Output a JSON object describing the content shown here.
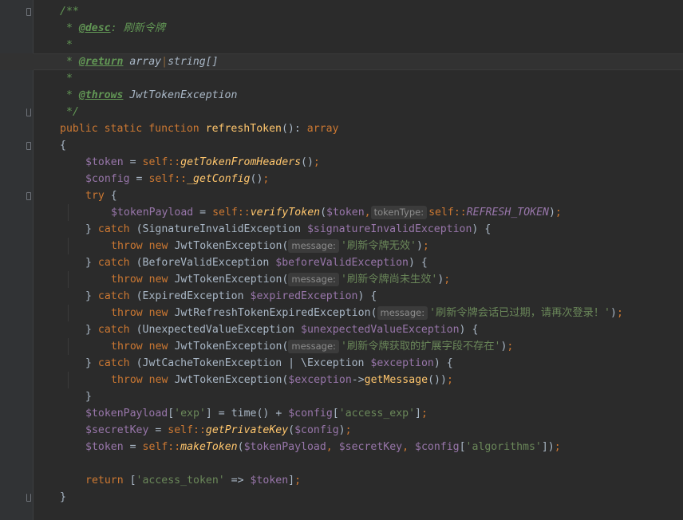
{
  "editor": {
    "lines": [
      "/**",
      " * @desc: 刷新令牌",
      " *",
      " * @return array|string[]",
      " *",
      " * @throws JwtTokenException",
      " */",
      "public static function refreshToken(): array",
      "{",
      "    $token = self::getTokenFromHeaders();",
      "    $config = self::_getConfig();",
      "    try {",
      "        $tokenPayload = self::verifyToken($token, tokenType: self::REFRESH_TOKEN);",
      "    } catch (SignatureInvalidException $signatureInvalidException) {",
      "        throw new JwtTokenException( message: '刷新令牌无效');",
      "    } catch (BeforeValidException $beforeValidException) {",
      "        throw new JwtTokenException( message: '刷新令牌尚未生效');",
      "    } catch (ExpiredException $expiredException) {",
      "        throw new JwtRefreshTokenExpiredException( message: '刷新令牌会话已过期，请再次登录！');",
      "    } catch (UnexpectedValueException $unexpectedValueException) {",
      "        throw new JwtTokenException( message: '刷新令牌获取的扩展字段不存在');",
      "    } catch (JwtCacheTokenException | \\Exception $exception) {",
      "        throw new JwtTokenException($exception->getMessage());",
      "    }",
      "    $tokenPayload['exp'] = time() + $config['access_exp'];",
      "    $secretKey = self::getPrivateKey($config);",
      "    $token = self::makeToken($tokenPayload, $secretKey, $config['algorithms']);",
      "",
      "    return ['access_token' => $token];",
      "}"
    ],
    "caret_line": 4,
    "colors": {
      "background": "#2b2b2b",
      "gutter": "#313335",
      "keyword": "#cc7832",
      "function": "#ffc66d",
      "variable": "#9876aa",
      "string": "#6a8759",
      "doc_comment": "#629755",
      "default_text": "#a9b7c6",
      "param_hint_bg": "#3b3b3b"
    }
  }
}
